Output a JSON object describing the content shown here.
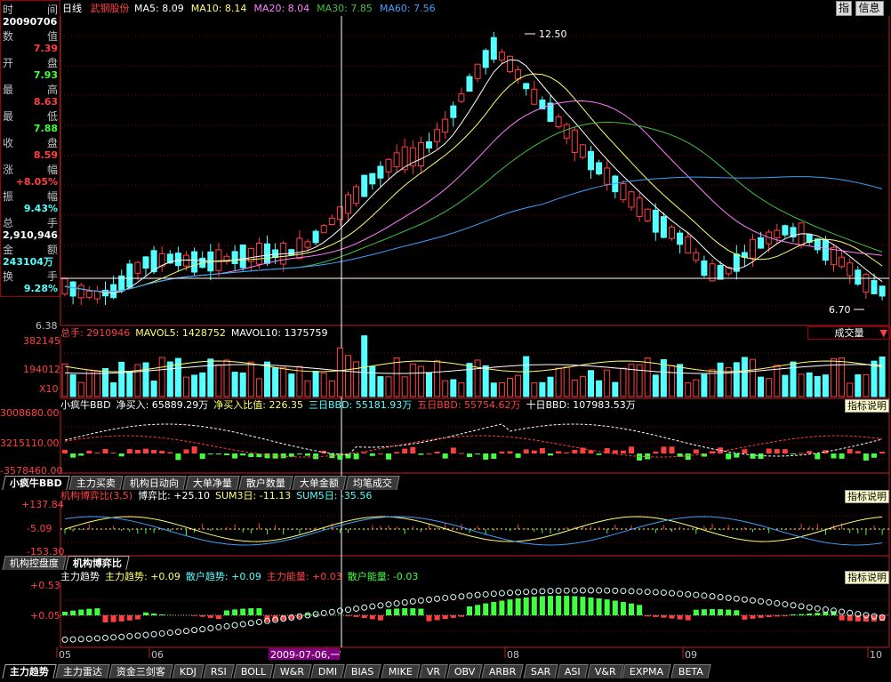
{
  "colors": {
    "up": "#ff4040",
    "down": "#54ffff",
    "ma5": "#ffffff",
    "ma10": "#ffff70",
    "ma20": "#ff80ff",
    "ma30": "#40c040",
    "ma60": "#40a0ff",
    "grid": "#8b0000",
    "axis": "#c02020"
  },
  "main": {
    "period": "日线",
    "stock": "武钢股份",
    "ma": [
      {
        "label": "MA5: 8.09",
        "color": "#ffffff"
      },
      {
        "label": "MA10: 8.14",
        "color": "#ffff70"
      },
      {
        "label": "MA20: 8.04",
        "color": "#ff80ff"
      },
      {
        "label": "MA30: 7.85",
        "color": "#40c040"
      },
      {
        "label": "MA60: 7.56",
        "color": "#40a0ff"
      }
    ],
    "max_label": "12.50",
    "min_label": "6.70",
    "y_bottom_label": "6.38",
    "buttons": {
      "zhi": "指",
      "info": "信息"
    }
  },
  "info_panel": {
    "rows": [
      {
        "a": "时",
        "b": "间",
        "value": "20090706",
        "color": "#ffffff"
      },
      {
        "a": "数",
        "b": "值",
        "value": "7.39",
        "color": "#ff4040"
      },
      {
        "a": "开",
        "b": "盘",
        "value": "7.93",
        "color": "#40ff40"
      },
      {
        "a": "最",
        "b": "高",
        "value": "8.63",
        "color": "#ff4040"
      },
      {
        "a": "最",
        "b": "低",
        "value": "7.88",
        "color": "#40ff40"
      },
      {
        "a": "收",
        "b": "盘",
        "value": "8.59",
        "color": "#ff4040"
      },
      {
        "a": "涨",
        "b": "幅",
        "value": "+8.05%",
        "color": "#ff4040"
      },
      {
        "a": "振",
        "b": "幅",
        "value": "9.43%",
        "color": "#54ffff"
      },
      {
        "a": "总",
        "b": "手",
        "value": "2,910,946",
        "color": "#ffffff"
      },
      {
        "a": "金",
        "b": "额",
        "value": "243104万",
        "color": "#54ffff"
      },
      {
        "a": "换",
        "b": "手",
        "value": "9.28%",
        "color": "#54ffff"
      }
    ]
  },
  "volume": {
    "legend": [
      {
        "text": "总手: 2910946",
        "color": "#ff4040"
      },
      {
        "text": "MAVOL5: 1428752",
        "color": "#ffff70"
      },
      {
        "text": "MAVOL10: 1375759",
        "color": "#ffffff"
      }
    ],
    "dropdown": "成交量",
    "y_labels": [
      "382145",
      "194012",
      "X10"
    ]
  },
  "bbd": {
    "legend": [
      {
        "text": "小疯牛BBD",
        "color": "#ffffff"
      },
      {
        "text": "净买入: 65889.29万",
        "color": "#ffffff"
      },
      {
        "text": "净买入比值: 226.35",
        "color": "#ffff70"
      },
      {
        "text": "三日BBD: 55181.93万",
        "color": "#54ffff"
      },
      {
        "text": "五日BBD: 55754.62万",
        "color": "#ff4040"
      },
      {
        "text": "十日BBD: 107983.53万",
        "color": "#ffffff"
      }
    ],
    "y_labels": [
      "3008680.00",
      "3215110.00",
      "-3578460.00"
    ],
    "explain": "指标说明",
    "tabs": [
      "小疯牛BBD",
      "主力买卖",
      "机构日动向",
      "大单净量",
      "散户数量",
      "大单金额",
      "均笔成交"
    ]
  },
  "game": {
    "legend": [
      {
        "text": "机构博弈比(3,5)",
        "color": "#ff4040"
      },
      {
        "text": "博弈比: +25.10",
        "color": "#ffffff"
      },
      {
        "text": "SUM3日: -11.13",
        "color": "#ffff70"
      },
      {
        "text": "SUM5日: -35.56",
        "color": "#54ffff"
      }
    ],
    "y_labels": [
      "+137.84",
      "-5.09",
      "-153.30"
    ],
    "explain": "指标说明",
    "tabs": [
      "机构控盘度",
      "机构博弈比"
    ]
  },
  "trend": {
    "legend": [
      {
        "text": "主力趋势",
        "color": "#ffffff"
      },
      {
        "text": "主力趋势: +0.09",
        "color": "#ffff70"
      },
      {
        "text": "散户趋势: +0.09",
        "color": "#54ffff"
      },
      {
        "text": "主力能量: +0.03",
        "color": "#ff4040"
      },
      {
        "text": "散户能量: -0.03",
        "color": "#40ff40"
      }
    ],
    "y_labels": [
      "+0.53",
      "+0.05"
    ],
    "explain": "指标说明"
  },
  "xaxis": {
    "labels": [
      "05",
      "06",
      "07",
      "08",
      "09",
      "10"
    ],
    "cursor_date": "2009-07-06,一"
  },
  "bottom_tabs": [
    "主力趋势",
    "主力雷达",
    "资金三剑客",
    "KDJ",
    "RSI",
    "BOLL",
    "W&R",
    "DMI",
    "BIAS",
    "MIKE",
    "VR",
    "OBV",
    "ARBR",
    "SAR",
    "ASI",
    "V&R",
    "EXPMA",
    "BETA"
  ]
}
